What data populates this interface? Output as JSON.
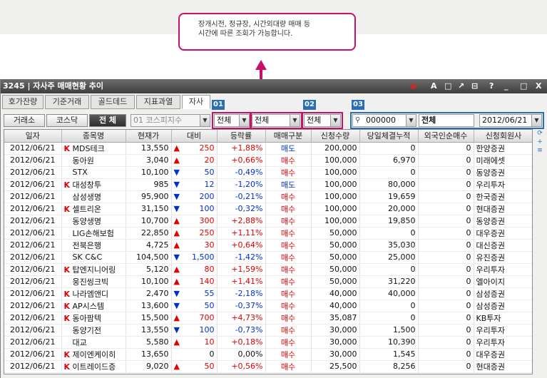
{
  "callout": {
    "line1": "장개시전, 정규장, 시간외대량 매매 등",
    "line2": "시간에 따른 조회가 가능합니다."
  },
  "top_tabs": [
    "호가잔량",
    "기준거래",
    "골드데드",
    "지표과열",
    "자사주"
  ],
  "window": {
    "title": "3245 | 자사주 매매현황 추이",
    "controls": [
      "▶",
      "A",
      "□",
      "↗",
      "⊟",
      "?",
      "_",
      "□",
      "X"
    ]
  },
  "tabs": [
    "호가잔량",
    "기준거래",
    "골드데드",
    "지표과열",
    "자사"
  ],
  "badges": [
    "01",
    "02",
    "03"
  ],
  "toolbar": {
    "market_buttons": [
      "거래소",
      "코스닥",
      "전 체"
    ],
    "index_combo": "01  코스피지수",
    "filter1": "전체",
    "filter2": "전체",
    "filter3": "전체",
    "code_value": "000000",
    "name_value": "전체",
    "date_value": "2012/06/21"
  },
  "table": {
    "headers": [
      "일자",
      "종목명",
      "현재가",
      "대비",
      "등락률",
      "매매구분",
      "신청수량",
      "당일체결누적",
      "외국인순매수",
      "신청회원사"
    ],
    "rows": [
      {
        "date": "2012/06/21",
        "k": "K",
        "name": "MDS테크",
        "price": "13,550",
        "dir": "up",
        "diff": "250",
        "rate": "+1,88%",
        "type": "매도",
        "qty": "200,000",
        "cum": "0",
        "foreign": "0",
        "broker": "한양증권"
      },
      {
        "date": "2012/06/21",
        "k": "",
        "name": "동아원",
        "price": "3,040",
        "dir": "up",
        "diff": "20",
        "rate": "+0,66%",
        "type": "매수",
        "qty": "100,000",
        "cum": "6,970",
        "foreign": "0",
        "broker": "미래에셋"
      },
      {
        "date": "2012/06/21",
        "k": "",
        "name": "STX",
        "price": "10,100",
        "dir": "down",
        "diff": "50",
        "rate": "-0,49%",
        "type": "매수",
        "qty": "100,000",
        "cum": "0",
        "foreign": "0",
        "broker": "동양증권"
      },
      {
        "date": "2012/06/21",
        "k": "K",
        "name": "대성창투",
        "price": "985",
        "dir": "down",
        "diff": "12",
        "rate": "-1,20%",
        "type": "매도",
        "qty": "100,000",
        "cum": "80,000",
        "foreign": "0",
        "broker": "우리투자"
      },
      {
        "date": "2012/06/21",
        "k": "",
        "name": "삼성생명",
        "price": "95,900",
        "dir": "down",
        "diff": "200",
        "rate": "-0,21%",
        "type": "매수",
        "qty": "100,000",
        "cum": "19,659",
        "foreign": "0",
        "broker": "한국증권"
      },
      {
        "date": "2012/06/21",
        "k": "K",
        "name": "셀트리온",
        "price": "31,150",
        "dir": "down",
        "diff": "100",
        "rate": "-0,32%",
        "type": "매수",
        "qty": "100,000",
        "cum": "20,000",
        "foreign": "0",
        "broker": "현대증권"
      },
      {
        "date": "2012/06/21",
        "k": "",
        "name": "동양생명",
        "price": "10,700",
        "dir": "up",
        "diff": "300",
        "rate": "+2,88%",
        "type": "매수",
        "qty": "100,000",
        "cum": "19,850",
        "foreign": "0",
        "broker": "동양증권"
      },
      {
        "date": "2012/06/21",
        "k": "",
        "name": "LIG손해보험",
        "price": "22,850",
        "dir": "up",
        "diff": "250",
        "rate": "+1,11%",
        "type": "매수",
        "qty": "50,000",
        "cum": "0",
        "foreign": "0",
        "broker": "대우증권"
      },
      {
        "date": "2012/06/21",
        "k": "",
        "name": "전북은행",
        "price": "4,725",
        "dir": "up",
        "diff": "30",
        "rate": "+0,64%",
        "type": "매수",
        "qty": "50,000",
        "cum": "35,030",
        "foreign": "0",
        "broker": "대신증권"
      },
      {
        "date": "2012/06/21",
        "k": "",
        "name": "SK C&C",
        "price": "104,500",
        "dir": "down",
        "diff": "1,500",
        "rate": "-1,42%",
        "type": "매수",
        "qty": "50,000",
        "cum": "25,000",
        "foreign": "0",
        "broker": "유진증권"
      },
      {
        "date": "2012/06/21",
        "k": "K",
        "name": "탑엔지니어링",
        "price": "5,120",
        "dir": "up",
        "diff": "80",
        "rate": "+1,59%",
        "type": "매수",
        "qty": "50,000",
        "cum": "0",
        "foreign": "0",
        "broker": "우리투자"
      },
      {
        "date": "2012/06/21",
        "k": "",
        "name": "웅진씽크빅",
        "price": "10,100",
        "dir": "up",
        "diff": "140",
        "rate": "+1,41%",
        "type": "매수",
        "qty": "50,000",
        "cum": "31,220",
        "foreign": "0",
        "broker": "엘아이지"
      },
      {
        "date": "2012/06/21",
        "k": "K",
        "name": "나라엠앤디",
        "price": "2,470",
        "dir": "down",
        "diff": "55",
        "rate": "-2,18%",
        "type": "매수",
        "qty": "40,000",
        "cum": "40,000",
        "foreign": "0",
        "broker": "삼성증권"
      },
      {
        "date": "2012/06/21",
        "k": "K",
        "name": "AP시스템",
        "price": "13,600",
        "dir": "down",
        "diff": "50",
        "rate": "-0,37%",
        "type": "매수",
        "qty": "40,000",
        "cum": "0",
        "foreign": "0",
        "broker": "삼성증권"
      },
      {
        "date": "2012/06/21",
        "k": "K",
        "name": "동아팜텍",
        "price": "15,500",
        "dir": "up",
        "diff": "700",
        "rate": "+4,73%",
        "type": "매수",
        "qty": "35,087",
        "cum": "0",
        "foreign": "0",
        "broker": "KB투자"
      },
      {
        "date": "2012/06/21",
        "k": "",
        "name": "동양기전",
        "price": "13,550",
        "dir": "down",
        "diff": "100",
        "rate": "-0,73%",
        "type": "매수",
        "qty": "30,000",
        "cum": "1,500",
        "foreign": "0",
        "broker": "우리투자"
      },
      {
        "date": "2012/06/21",
        "k": "",
        "name": "대교",
        "price": "5,580",
        "dir": "up",
        "diff": "10",
        "rate": "+0,18%",
        "type": "매수",
        "qty": "30,000",
        "cum": "10,390",
        "foreign": "0",
        "broker": "우리투자"
      },
      {
        "date": "2012/06/21",
        "k": "K",
        "name": "제이엔케이히",
        "price": "13,650",
        "dir": "none",
        "diff": "0",
        "rate": "0,00%",
        "type": "매수",
        "qty": "30,000",
        "cum": "1,545",
        "foreign": "0",
        "broker": "대우증권"
      },
      {
        "date": "2012/06/21",
        "k": "K",
        "name": "이트레이드증",
        "price": "9,020",
        "dir": "up",
        "diff": "50",
        "rate": "+0,56%",
        "type": "매수",
        "qty": "25,500",
        "cum": "8,256",
        "foreign": "0",
        "broker": "현대증권"
      }
    ]
  },
  "colors": {
    "highlight": "#c8106a",
    "badge": "#2a6fb6",
    "up": "#e00000",
    "down": "#0030d0"
  }
}
